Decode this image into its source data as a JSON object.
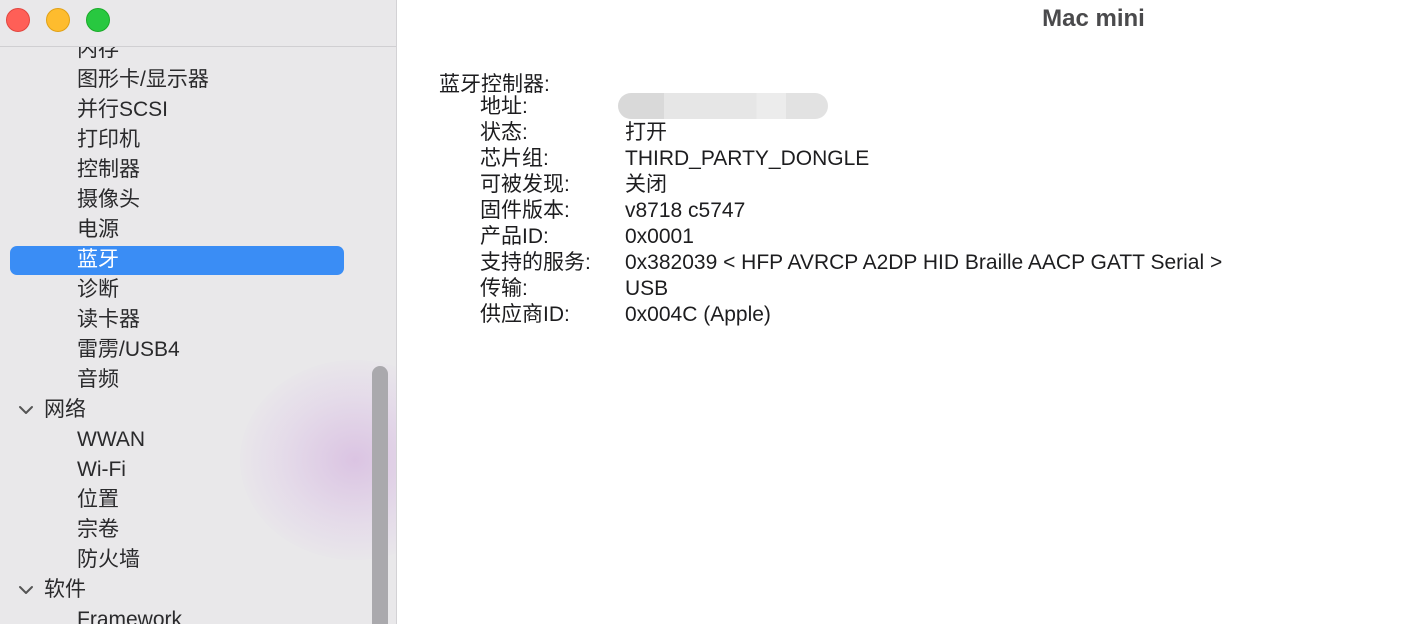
{
  "window": {
    "title": "Mac mini"
  },
  "sidebar": {
    "items": [
      {
        "label": "内存",
        "level": "child",
        "selected": false
      },
      {
        "label": "图形卡/显示器",
        "level": "child",
        "selected": false
      },
      {
        "label": "并行SCSI",
        "level": "child",
        "selected": false
      },
      {
        "label": "打印机",
        "level": "child",
        "selected": false
      },
      {
        "label": "控制器",
        "level": "child",
        "selected": false
      },
      {
        "label": "摄像头",
        "level": "child",
        "selected": false
      },
      {
        "label": "电源",
        "level": "child",
        "selected": false
      },
      {
        "label": "蓝牙",
        "level": "child",
        "selected": true
      },
      {
        "label": "诊断",
        "level": "child",
        "selected": false
      },
      {
        "label": "读卡器",
        "level": "child",
        "selected": false
      },
      {
        "label": "雷雳/USB4",
        "level": "child",
        "selected": false
      },
      {
        "label": "音频",
        "level": "child",
        "selected": false
      },
      {
        "label": "网络",
        "level": "group",
        "expanded": true
      },
      {
        "label": "WWAN",
        "level": "child",
        "selected": false
      },
      {
        "label": "Wi-Fi",
        "level": "child",
        "selected": false
      },
      {
        "label": "位置",
        "level": "child",
        "selected": false
      },
      {
        "label": "宗卷",
        "level": "child",
        "selected": false
      },
      {
        "label": "防火墙",
        "level": "child",
        "selected": false
      },
      {
        "label": "软件",
        "level": "group",
        "expanded": true
      },
      {
        "label": "Framework",
        "level": "child",
        "selected": false
      }
    ]
  },
  "detail": {
    "section_title": "蓝牙控制器:",
    "properties": [
      {
        "key": "地址:",
        "value": "",
        "redacted": true
      },
      {
        "key": "状态:",
        "value": "打开"
      },
      {
        "key": "芯片组:",
        "value": "THIRD_PARTY_DONGLE"
      },
      {
        "key": "可被发现:",
        "value": "关闭"
      },
      {
        "key": "固件版本:",
        "value": "v8718 c5747"
      },
      {
        "key": "产品ID:",
        "value": "0x0001"
      },
      {
        "key": "支持的服务:",
        "value": "0x382039 < HFP AVRCP A2DP HID Braille AACP GATT Serial >"
      },
      {
        "key": "传输:",
        "value": "USB"
      },
      {
        "key": "供应商ID:",
        "value": "0x004C (Apple)"
      }
    ]
  },
  "colors": {
    "selection": "#3a8df5",
    "sidebar_bg": "#e9e8ea",
    "close": "#ff5f57",
    "minimize": "#febc2e",
    "zoom": "#28c840"
  },
  "icons": {
    "group_toggle": "chevron-down-icon",
    "close": "close-traffic-light-icon",
    "minimize": "minimize-traffic-light-icon",
    "zoom": "zoom-traffic-light-icon"
  }
}
